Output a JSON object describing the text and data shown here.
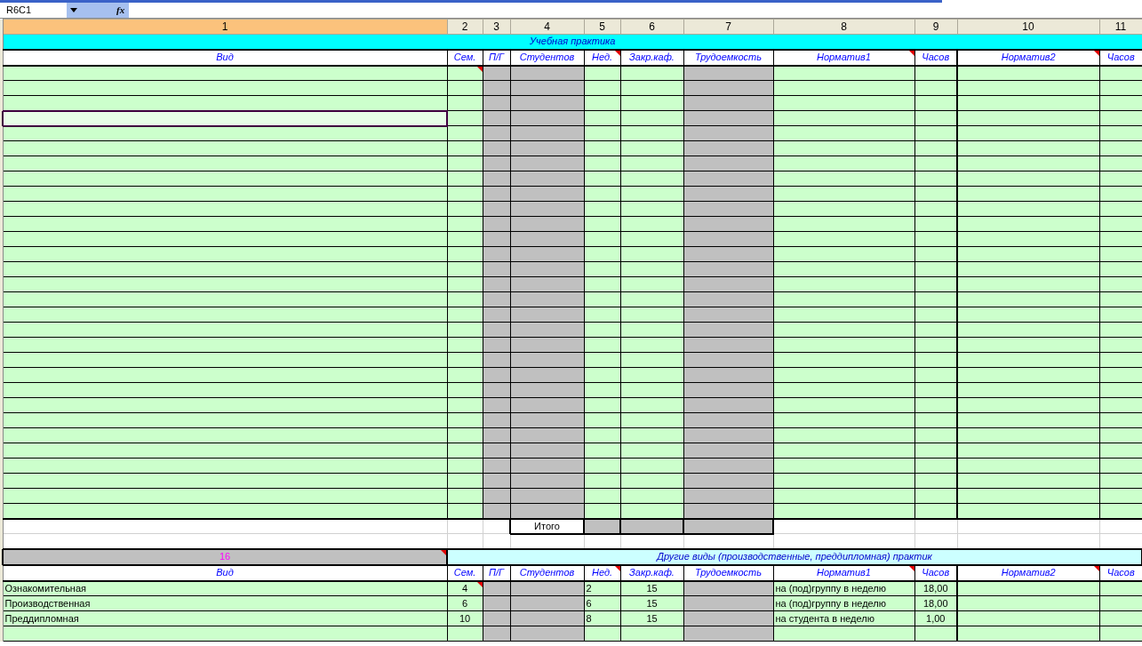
{
  "name_box": "R6C1",
  "formula_label": "fx",
  "columns": [
    {
      "label": "1",
      "selected": true
    },
    {
      "label": "2",
      "selected": false
    },
    {
      "label": "3",
      "selected": false
    },
    {
      "label": "4",
      "selected": false
    },
    {
      "label": "5",
      "selected": false
    },
    {
      "label": "6",
      "selected": false
    },
    {
      "label": "7",
      "selected": false
    },
    {
      "label": "8",
      "selected": false
    },
    {
      "label": "9",
      "selected": false
    },
    {
      "label": "10",
      "selected": false
    },
    {
      "label": "11",
      "selected": false
    }
  ],
  "practice": {
    "title": "Учебная практика",
    "headers": [
      {
        "text": "Вид",
        "comment": false,
        "shaded": false
      },
      {
        "text": "Сем.",
        "comment": false,
        "shaded": false
      },
      {
        "text": "П/Г",
        "comment": false,
        "shaded": true
      },
      {
        "text": "Студентов",
        "comment": false,
        "shaded": true
      },
      {
        "text": "Нед.",
        "comment": true,
        "shaded": false
      },
      {
        "text": "Закр.каф.",
        "comment": false,
        "shaded": false
      },
      {
        "text": "Трудоемкость",
        "comment": false,
        "shaded": true
      },
      {
        "text": "Норматив1",
        "comment": true,
        "shaded": false
      },
      {
        "text": "Часов",
        "comment": false,
        "shaded": false
      },
      {
        "text": "Норматив2",
        "comment": true,
        "shaded": false
      },
      {
        "text": "Часов",
        "comment": false,
        "shaded": false
      }
    ],
    "rows": [
      {
        "selected": false,
        "comment": true
      },
      {
        "selected": false,
        "comment": false
      },
      {
        "selected": false,
        "comment": false
      },
      {
        "selected": true,
        "comment": false
      },
      {
        "selected": false,
        "comment": false
      },
      {
        "selected": false,
        "comment": false
      },
      {
        "selected": false,
        "comment": false
      },
      {
        "selected": false,
        "comment": false
      },
      {
        "selected": false,
        "comment": false
      },
      {
        "selected": false,
        "comment": false
      },
      {
        "selected": false,
        "comment": false
      },
      {
        "selected": false,
        "comment": false
      },
      {
        "selected": false,
        "comment": false
      },
      {
        "selected": false,
        "comment": false
      },
      {
        "selected": false,
        "comment": false
      },
      {
        "selected": false,
        "comment": false
      },
      {
        "selected": false,
        "comment": false
      },
      {
        "selected": false,
        "comment": false
      },
      {
        "selected": false,
        "comment": false
      },
      {
        "selected": false,
        "comment": false
      },
      {
        "selected": false,
        "comment": false
      },
      {
        "selected": false,
        "comment": false
      },
      {
        "selected": false,
        "comment": false
      },
      {
        "selected": false,
        "comment": false
      },
      {
        "selected": false,
        "comment": false
      },
      {
        "selected": false,
        "comment": false
      },
      {
        "selected": false,
        "comment": false
      },
      {
        "selected": false,
        "comment": false
      },
      {
        "selected": false,
        "comment": false
      },
      {
        "selected": false,
        "comment": false
      }
    ],
    "total_label": "Итого"
  },
  "other": {
    "band": {
      "text": "16",
      "comment": true
    },
    "title": "Другие виды (производственные, преддипломная) практик",
    "headers": [
      {
        "text": "Вид",
        "comment": false,
        "shaded": false
      },
      {
        "text": "Сем.",
        "comment": false,
        "shaded": false
      },
      {
        "text": "П/Г",
        "comment": false,
        "shaded": true
      },
      {
        "text": "Студентов",
        "comment": false,
        "shaded": true
      },
      {
        "text": "Нед.",
        "comment": true,
        "shaded": false
      },
      {
        "text": "Закр.каф.",
        "comment": false,
        "shaded": false
      },
      {
        "text": "Трудоемкость",
        "comment": false,
        "shaded": true
      },
      {
        "text": "Норматив1",
        "comment": true,
        "shaded": false
      },
      {
        "text": "Часов",
        "comment": false,
        "shaded": false
      },
      {
        "text": "Норматив2",
        "comment": true,
        "shaded": false
      },
      {
        "text": "Часов",
        "comment": false,
        "shaded": false
      }
    ],
    "rows": [
      {
        "vid": "Ознакомительная",
        "sem": "4",
        "sem_comment": true,
        "ned": "2",
        "zakr": "15",
        "norm1": "на (под)группу в неделю",
        "hours1": "18,00"
      },
      {
        "vid": "Производственная",
        "sem": "6",
        "sem_comment": false,
        "ned": "6",
        "zakr": "15",
        "norm1": "на (под)группу в неделю",
        "hours1": "18,00"
      },
      {
        "vid": "Преддипломная",
        "sem": "10",
        "sem_comment": false,
        "ned": "8",
        "zakr": "15",
        "norm1": "на студента в неделю",
        "hours1": "1,00"
      }
    ]
  }
}
